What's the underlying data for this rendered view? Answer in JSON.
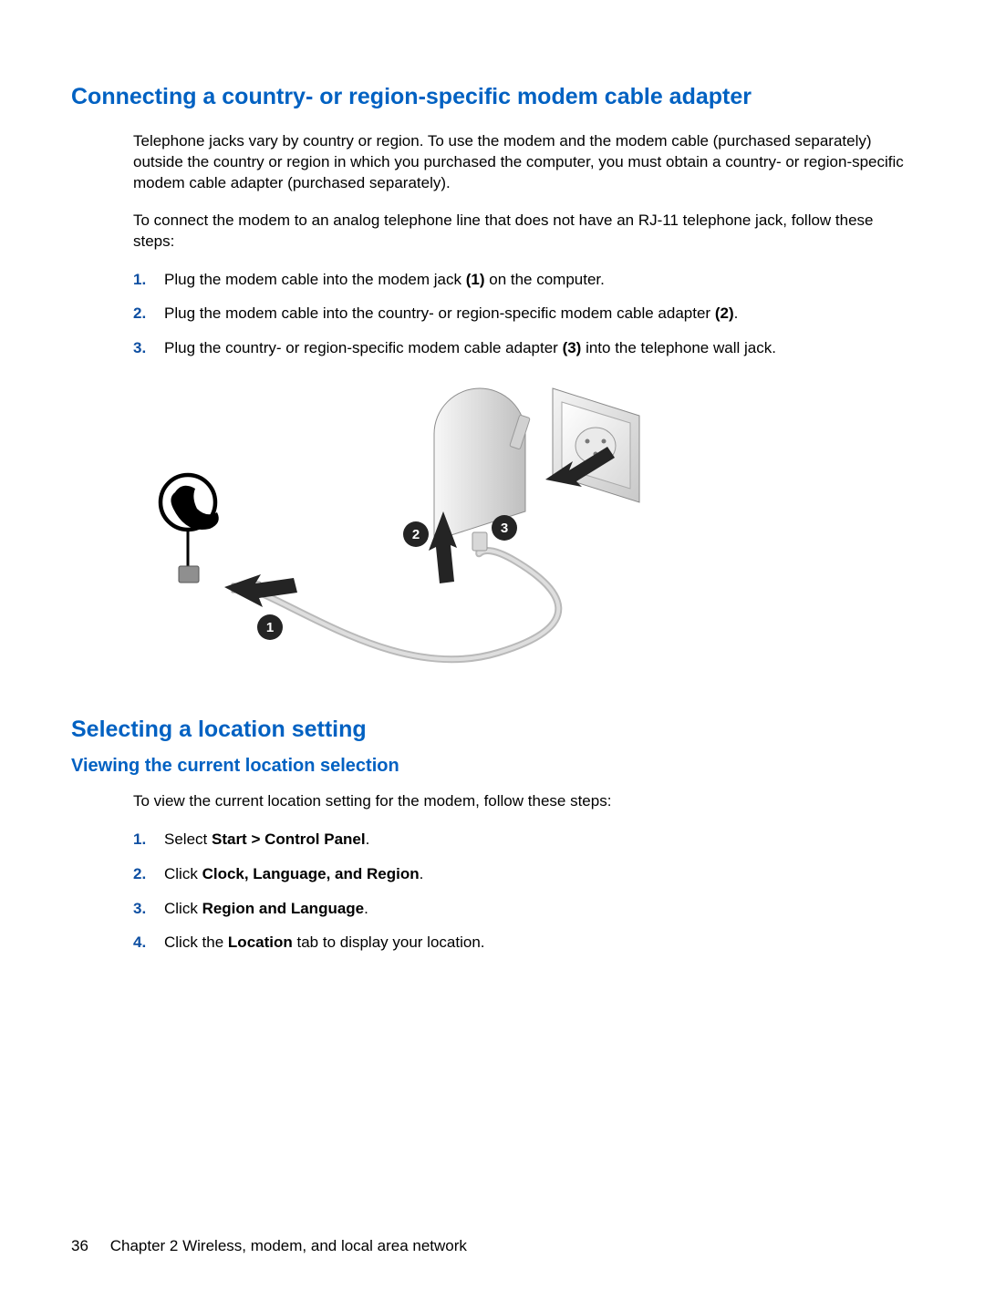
{
  "section1": {
    "heading": "Connecting a country- or region-specific modem cable adapter",
    "para1": "Telephone jacks vary by country or region. To use the modem and the modem cable (purchased separately) outside the country or region in which you purchased the computer, you must obtain a country- or region-specific modem cable adapter (purchased separately).",
    "para2": "To connect the modem to an analog telephone line that does not have an RJ-11 telephone jack, follow these steps:",
    "steps": [
      {
        "num": "1.",
        "pre": "Plug the modem cable into the modem jack ",
        "bold": "(1)",
        "post": " on the computer."
      },
      {
        "num": "2.",
        "pre": "Plug the modem cable into the country- or region-specific modem cable adapter ",
        "bold": "(2)",
        "post": "."
      },
      {
        "num": "3.",
        "pre": "Plug the country- or region-specific modem cable adapter ",
        "bold": "(3)",
        "post": " into the telephone wall jack."
      }
    ],
    "callouts": {
      "c1": "1",
      "c2": "2",
      "c3": "3"
    }
  },
  "section2": {
    "heading": "Selecting a location setting",
    "sub1": {
      "heading": "Viewing the current location selection",
      "intro": "To view the current location setting for the modem, follow these steps:",
      "steps": [
        {
          "num": "1.",
          "pre": "Select ",
          "bold": "Start > Control Panel",
          "post": "."
        },
        {
          "num": "2.",
          "pre": "Click ",
          "bold": "Clock, Language, and Region",
          "post": "."
        },
        {
          "num": "3.",
          "pre": "Click ",
          "bold": "Region and Language",
          "post": "."
        },
        {
          "num": "4.",
          "pre": "Click the ",
          "bold": "Location",
          "post": " tab to display your location."
        }
      ]
    }
  },
  "footer": {
    "page": "36",
    "chapter": "Chapter 2   Wireless, modem, and local area network"
  }
}
